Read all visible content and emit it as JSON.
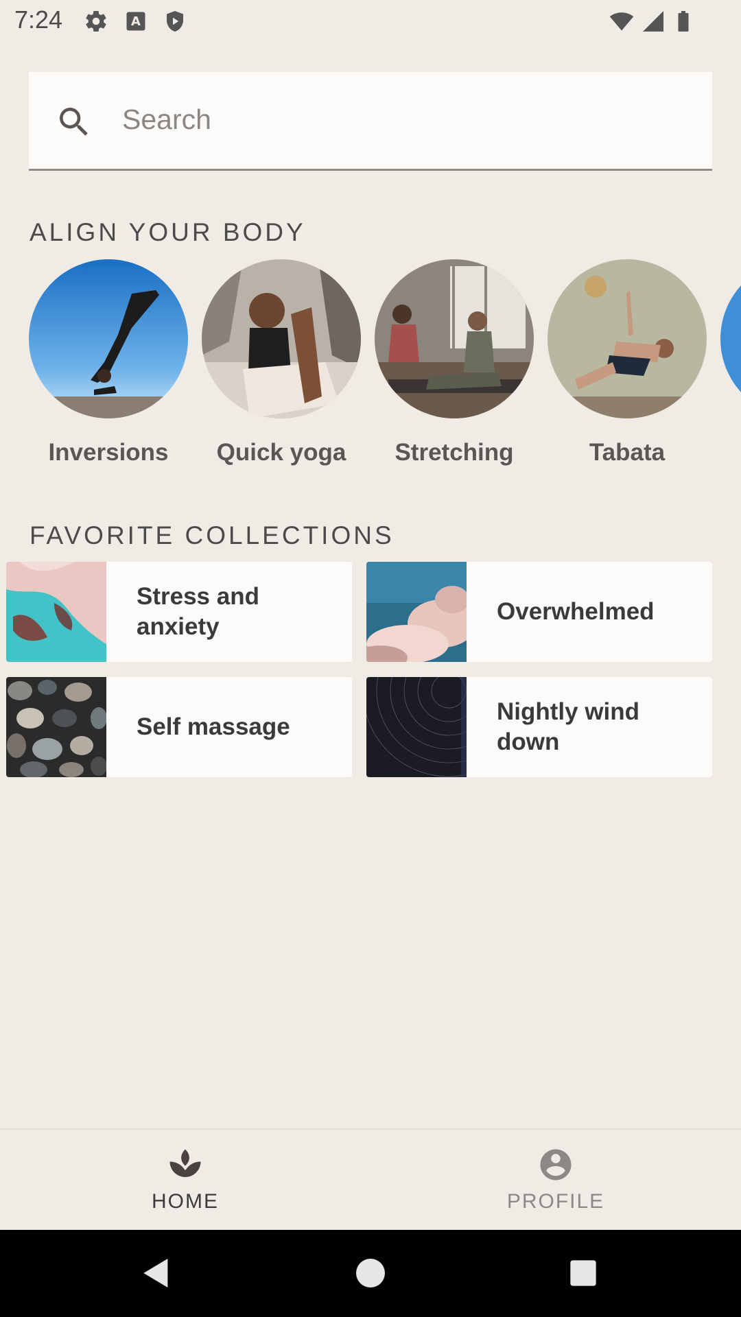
{
  "status_bar": {
    "time": "7:24",
    "left_icons": [
      "gear-icon",
      "keyboard-a-icon",
      "shield-play-icon"
    ],
    "right_icons": [
      "wifi-icon",
      "cell-signal-icon",
      "battery-icon"
    ]
  },
  "search": {
    "placeholder": "Search",
    "value": ""
  },
  "align_section": {
    "title": "ALIGN YOUR BODY",
    "items": [
      {
        "label": "Inversions"
      },
      {
        "label": "Quick yoga"
      },
      {
        "label": "Stretching"
      },
      {
        "label": "Tabata"
      }
    ]
  },
  "collections_section": {
    "title": "FAVORITE COLLECTIONS",
    "items": [
      {
        "label": "Stress and anxiety"
      },
      {
        "label": "Overwhelmed"
      },
      {
        "label": "Self massage"
      },
      {
        "label": "Nightly wind down"
      }
    ]
  },
  "bottom_nav": {
    "home_label": "HOME",
    "profile_label": "PROFILE",
    "active": "HOME",
    "active_color": "#3b3b3b",
    "inactive_color": "#8c8885"
  },
  "system_nav": {
    "icons": [
      "back-icon",
      "home-circle-icon",
      "recents-icon"
    ]
  }
}
